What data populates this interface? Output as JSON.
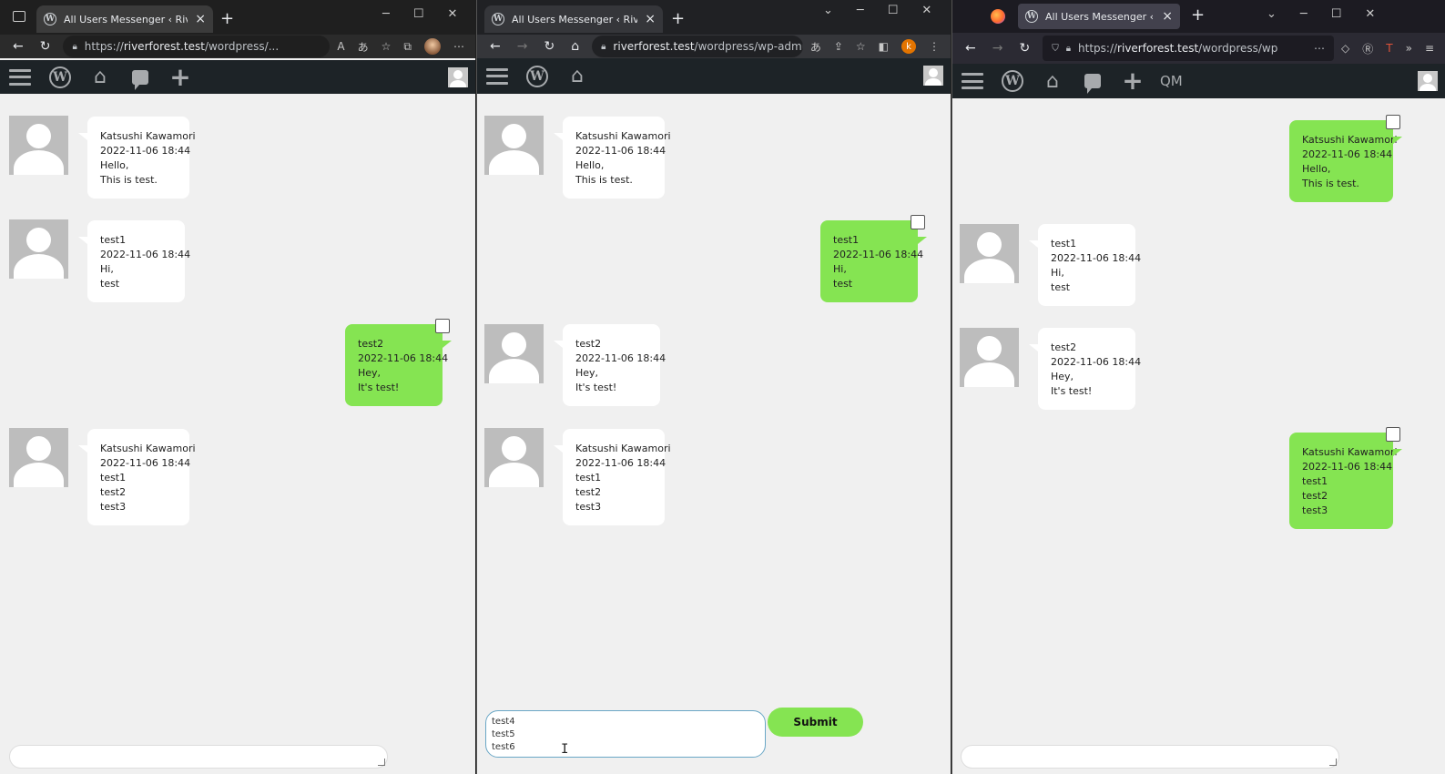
{
  "tab_title": "All Users Messenger ‹ Riverforest",
  "windows": [
    {
      "url_prefix": "https://",
      "url_host": "riverforest.test",
      "url_path": "/wordpress/...",
      "messages": [
        {
          "dir": "in",
          "author": "Katsushi Kawamori",
          "date": "2022-11-06 18:44",
          "lines": [
            "Hello,",
            "This is test."
          ]
        },
        {
          "dir": "in",
          "author": "test1",
          "date": "2022-11-06 18:44",
          "lines": [
            "Hi,",
            "test"
          ]
        },
        {
          "dir": "out",
          "author": "test2",
          "date": "2022-11-06 18:44",
          "lines": [
            "Hey,",
            "It's test!"
          ]
        },
        {
          "dir": "in",
          "author": "Katsushi Kawamori",
          "date": "2022-11-06 18:44",
          "lines": [
            "test1",
            "test2",
            "test3"
          ]
        }
      ]
    },
    {
      "url_prefix": "",
      "url_host": "riverforest.test",
      "url_path": "/wordpress/wp-admin/a...",
      "profile_initial": "k",
      "messages": [
        {
          "dir": "in",
          "author": "Katsushi Kawamori",
          "date": "2022-11-06 18:44",
          "lines": [
            "Hello,",
            "This is test."
          ]
        },
        {
          "dir": "out",
          "author": "test1",
          "date": "2022-11-06 18:44",
          "lines": [
            "Hi,",
            "test"
          ]
        },
        {
          "dir": "in",
          "author": "test2",
          "date": "2022-11-06 18:44",
          "lines": [
            "Hey,",
            "It's test!"
          ]
        },
        {
          "dir": "in",
          "author": "Katsushi Kawamori",
          "date": "2022-11-06 18:44",
          "lines": [
            "test1",
            "test2",
            "test3"
          ]
        }
      ],
      "composer_value": "test4\ntest5\ntest6",
      "submit_label": "Submit"
    },
    {
      "url_prefix": "https://",
      "url_host": "riverforest.test",
      "url_path": "/wordpress/wp",
      "qm_label": "QM",
      "messages": [
        {
          "dir": "out",
          "author": "Katsushi Kawamori",
          "date": "2022-11-06 18:44",
          "lines": [
            "Hello,",
            "This is test."
          ]
        },
        {
          "dir": "in",
          "author": "test1",
          "date": "2022-11-06 18:44",
          "lines": [
            "Hi,",
            "test"
          ]
        },
        {
          "dir": "in",
          "author": "test2",
          "date": "2022-11-06 18:44",
          "lines": [
            "Hey,",
            "It's test!"
          ]
        },
        {
          "dir": "out",
          "author": "Katsushi Kawamori",
          "date": "2022-11-06 18:44",
          "lines": [
            "test1",
            "test2",
            "test3"
          ]
        }
      ]
    }
  ],
  "colors": {
    "outgoing_bubble": "#85e452",
    "incoming_bubble": "#ffffff",
    "admin_bar": "#1d2327"
  }
}
